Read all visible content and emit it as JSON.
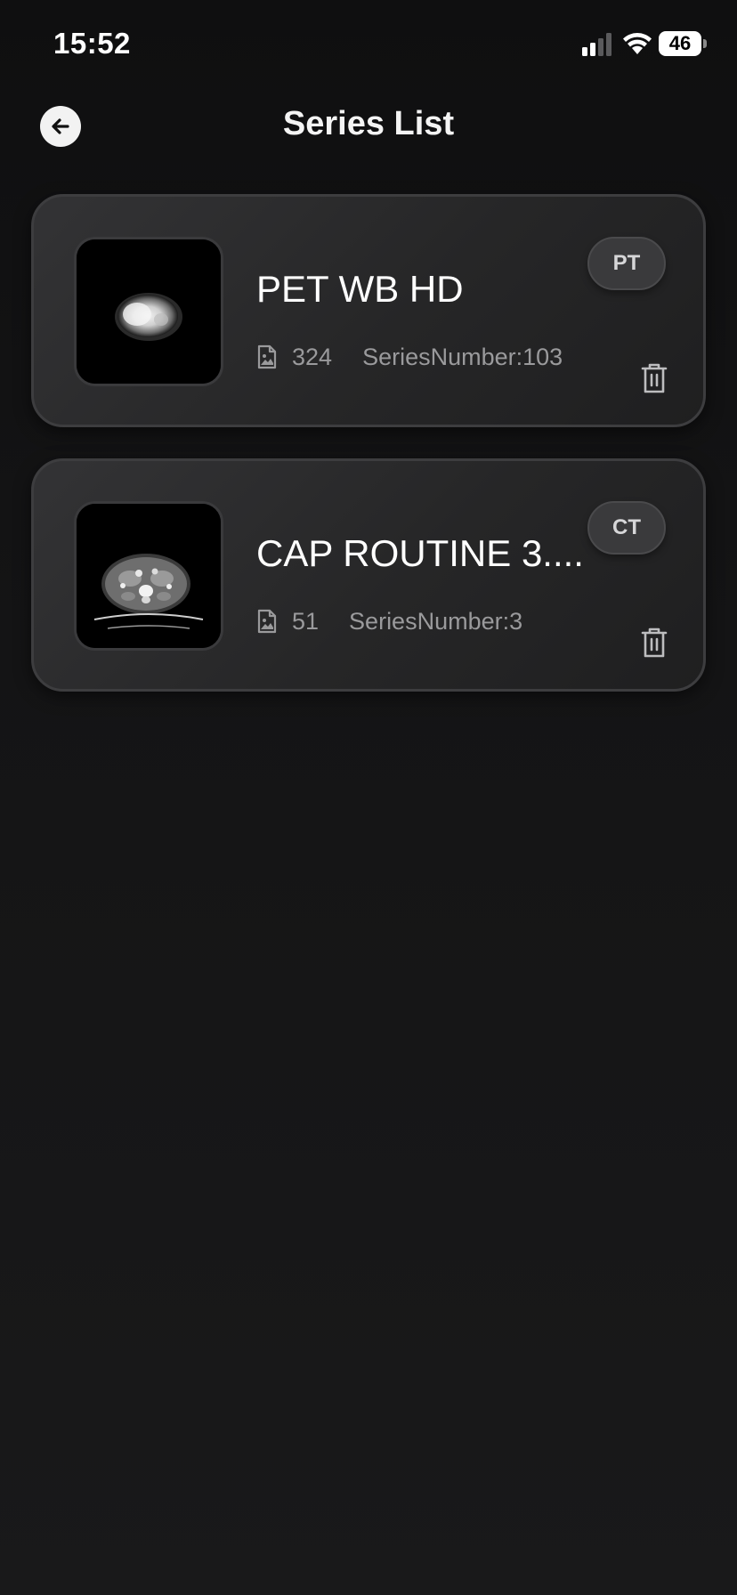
{
  "status_bar": {
    "time": "15:52",
    "battery_level": "46",
    "icons": [
      "signal-icon",
      "wifi-icon",
      "battery-icon"
    ]
  },
  "header": {
    "title": "Series List",
    "back_icon": "arrow-left-icon"
  },
  "series": [
    {
      "title": "PET WB HD",
      "modality": "PT",
      "count": "324",
      "series_number": "SeriesNumber:103",
      "thumbnail": "pet-scan-thumbnail",
      "delete_icon": "trash-icon"
    },
    {
      "title": "CAP ROUTINE 3....",
      "modality": "CT",
      "count": "51",
      "series_number": "SeriesNumber:3",
      "thumbnail": "ct-scan-thumbnail",
      "delete_icon": "trash-icon"
    }
  ],
  "colors": {
    "background": "#141415",
    "card": "#2a2a2b",
    "badge": "#3a3a3c",
    "secondary_text": "#9a9a9c"
  }
}
